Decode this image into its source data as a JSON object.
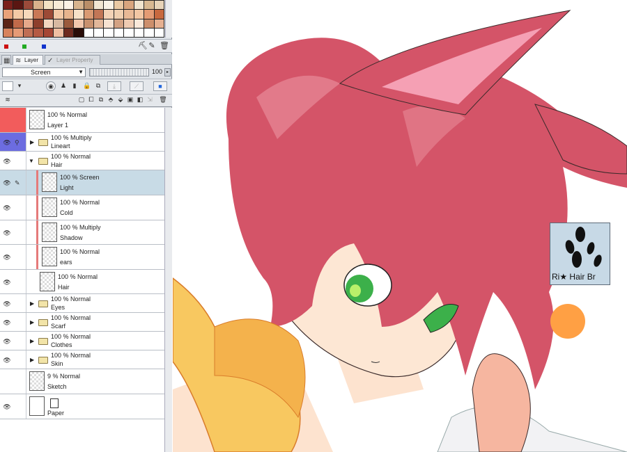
{
  "palette": {
    "swatches": [
      "#7a1f1a",
      "#5a1612",
      "#9b4a3a",
      "#d9b28c",
      "#f3e3c4",
      "#f7ecd8",
      "#fbf3e6",
      "#d7b48e",
      "#b98e68",
      "#f2e6d2",
      "#faf3e8",
      "#e9c9a4",
      "#d9a57e",
      "#f0e4cf",
      "#d8b892",
      "#e7d3b8",
      "#e9a27a",
      "#f4caa6",
      "#f6d9bc",
      "#c97856",
      "#9c4a36",
      "#f3c9a6",
      "#e7b48e",
      "#f6e1c8",
      "#d99a73",
      "#c27656",
      "#f3d3b7",
      "#efcfb0",
      "#e8b996",
      "#f2c7a4",
      "#e49b74",
      "#c8693f",
      "#5c2416",
      "#c06a4a",
      "#e6a98a",
      "#8e3f2c",
      "#f3d6c0",
      "#d8b9a2",
      "#9a5a3d",
      "#f2c8ae",
      "#c8916f",
      "#e2b79a",
      "#f7e3d2",
      "#d3a283",
      "#efcbb2",
      "#fbe9da",
      "#cd8f6c",
      "#e6b091",
      "#d7835d",
      "#e59a76",
      "#c06e54",
      "#b55a44",
      "#a54635",
      "#f0bfa2",
      "#6e2b20",
      "#2a0d08",
      "#ffffff",
      "#ffffff",
      "#ffffff",
      "#ffffff",
      "#ffffff",
      "#ffffff",
      "#ffffff",
      "#ffffff"
    ],
    "main_color": "#cc1111",
    "sub_color": "#22aa22",
    "third_color": "#1133cc"
  },
  "tabs": {
    "layer": "Layer",
    "layer_property": "Layer Property"
  },
  "blend": {
    "mode": "Screen",
    "opacity": "100"
  },
  "layers": [
    {
      "mode": "100 % Normal",
      "name": "Layer 1"
    },
    {
      "mode": "100 % Multiply",
      "name": "Lineart"
    },
    {
      "mode": "100 % Normal",
      "name": "Hair"
    },
    {
      "mode": "100 % Screen",
      "name": "Light"
    },
    {
      "mode": "100 % Normal",
      "name": "Cold"
    },
    {
      "mode": "100 % Multiply",
      "name": "Shadow"
    },
    {
      "mode": "100 % Normal",
      "name": "ears"
    },
    {
      "mode": "100 % Normal",
      "name": "Hair"
    },
    {
      "mode": "100 % Normal",
      "name": "Eyes"
    },
    {
      "mode": "100 % Normal",
      "name": "Scarf"
    },
    {
      "mode": "100 % Normal",
      "name": "Clothes"
    },
    {
      "mode": "100 % Normal",
      "name": "Skin"
    },
    {
      "mode": "9 % Normal",
      "name": "Sketch"
    },
    {
      "mode": "",
      "name": "Paper"
    }
  ],
  "colors": {
    "layer1_color": "#f25c5c",
    "lineart_color": "#6c6ce0",
    "selected_row": "#c8dbe6",
    "hair": "#d45468",
    "orange": "#ffa044"
  },
  "brush": {
    "label": "Ri★ Hair Br"
  }
}
